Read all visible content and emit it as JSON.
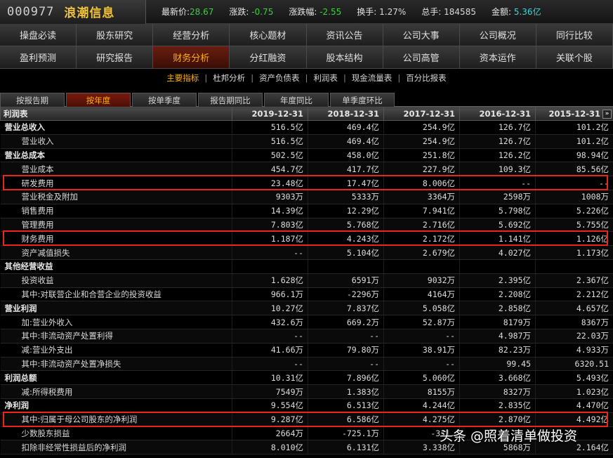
{
  "quote": {
    "code": "000977",
    "name": "浪潮信息",
    "latest_label": "最新价:",
    "latest_value": "28.67",
    "change_label": "涨跌:",
    "change_value": "-0.75",
    "pct_label": "涨跌幅:",
    "pct_value": "-2.55",
    "turnover_label": "换手:",
    "turnover_value": "1.27%",
    "volume_label": "总手:",
    "volume_value": "184585",
    "amount_label": "金额:",
    "amount_value": "5.36亿"
  },
  "nav": {
    "row1": [
      "操盘必读",
      "股东研究",
      "经营分析",
      "核心题材",
      "资讯公告",
      "公司大事",
      "公司概况",
      "同行比较"
    ],
    "row2": [
      "盈利预测",
      "研究报告",
      "财务分析",
      "分红融资",
      "股本结构",
      "公司高管",
      "资本运作",
      "关联个股"
    ],
    "active_row2_index": 2
  },
  "subtabs": [
    "主要指标",
    "杜邦分析",
    "资产负债表",
    "利润表",
    "现金流量表",
    "百分比报表"
  ],
  "subtab_sep": "|",
  "period_tabs": [
    "按报告期",
    "按年度",
    "按单季度",
    "报告期同比",
    "年度同比",
    "单季度环比"
  ],
  "table": {
    "header_label": "利润表",
    "columns": [
      "2019-12-31",
      "2018-12-31",
      "2017-12-31",
      "2016-12-31",
      "2015-12-31"
    ],
    "more_symbol": "»",
    "rows": [
      {
        "label": "营业总收入",
        "section": true,
        "values": [
          "516.5亿",
          "469.4亿",
          "254.9亿",
          "126.7亿",
          "101.2亿"
        ]
      },
      {
        "label": "营业收入",
        "section": false,
        "values": [
          "516.5亿",
          "469.4亿",
          "254.9亿",
          "126.7亿",
          "101.2亿"
        ]
      },
      {
        "label": "营业总成本",
        "section": true,
        "values": [
          "502.5亿",
          "458.0亿",
          "251.8亿",
          "126.2亿",
          "98.94亿"
        ]
      },
      {
        "label": "营业成本",
        "section": false,
        "values": [
          "454.7亿",
          "417.7亿",
          "227.9亿",
          "109.3亿",
          "85.56亿"
        ]
      },
      {
        "label": "研发费用",
        "section": false,
        "values": [
          "23.48亿",
          "17.47亿",
          "8.006亿",
          "--",
          "--"
        ]
      },
      {
        "label": "营业税金及附加",
        "section": false,
        "values": [
          "9303万",
          "5333万",
          "3364万",
          "2598万",
          "1008万"
        ]
      },
      {
        "label": "销售费用",
        "section": false,
        "values": [
          "14.39亿",
          "12.29亿",
          "7.941亿",
          "5.798亿",
          "5.226亿"
        ]
      },
      {
        "label": "管理费用",
        "section": false,
        "values": [
          "7.803亿",
          "5.768亿",
          "2.716亿",
          "5.692亿",
          "5.755亿"
        ]
      },
      {
        "label": "财务费用",
        "section": false,
        "values": [
          "1.187亿",
          "4.243亿",
          "2.172亿",
          "1.141亿",
          "1.126亿"
        ]
      },
      {
        "label": "资产减值损失",
        "section": false,
        "values": [
          "--",
          "5.104亿",
          "2.679亿",
          "4.027亿",
          "1.173亿"
        ]
      },
      {
        "label": "其他经营收益",
        "section": true,
        "values": [
          "",
          "",
          "",
          "",
          ""
        ]
      },
      {
        "label": "投资收益",
        "section": false,
        "values": [
          "1.628亿",
          "6591万",
          "9032万",
          "2.395亿",
          "2.367亿"
        ]
      },
      {
        "label": "其中:对联营企业和合营企业的投资收益",
        "section": false,
        "values": [
          "966.1万",
          "-2296万",
          "4164万",
          "2.208亿",
          "2.212亿"
        ]
      },
      {
        "label": "营业利润",
        "section": true,
        "values": [
          "10.27亿",
          "7.837亿",
          "5.058亿",
          "2.858亿",
          "4.657亿"
        ]
      },
      {
        "label": "加:营业外收入",
        "section": false,
        "values": [
          "432.6万",
          "669.2万",
          "52.87万",
          "8179万",
          "8367万"
        ]
      },
      {
        "label": "其中:非流动资产处置利得",
        "section": false,
        "values": [
          "--",
          "--",
          "--",
          "4.987万",
          "22.03万"
        ]
      },
      {
        "label": "减:营业外支出",
        "section": false,
        "values": [
          "41.66万",
          "79.80万",
          "38.91万",
          "82.23万",
          "4.933万"
        ]
      },
      {
        "label": "其中:非流动资产处置净损失",
        "section": false,
        "values": [
          "--",
          "--",
          "--",
          "99.45",
          "6320.51"
        ]
      },
      {
        "label": "利润总额",
        "section": true,
        "values": [
          "10.31亿",
          "7.896亿",
          "5.060亿",
          "3.668亿",
          "5.493亿"
        ]
      },
      {
        "label": "减:所得税费用",
        "section": false,
        "values": [
          "7549万",
          "1.383亿",
          "8155万",
          "8327万",
          "1.023亿"
        ]
      },
      {
        "label": "净利润",
        "section": true,
        "values": [
          "9.554亿",
          "6.513亿",
          "4.244亿",
          "2.835亿",
          "4.470亿"
        ]
      },
      {
        "label": "其中:归属于母公司股东的净利润",
        "section": false,
        "values": [
          "9.287亿",
          "6.586亿",
          "4.275亿",
          "2.870亿",
          "4.492亿"
        ]
      },
      {
        "label": "少数股东损益",
        "section": false,
        "values": [
          "2664万",
          "-725.1万",
          "-311.",
          "",
          ""
        ]
      },
      {
        "label": "扣除非经常性损益后的净利润",
        "section": false,
        "values": [
          "8.010亿",
          "6.131亿",
          "3.338亿",
          "5868万",
          "2.164亿"
        ]
      }
    ]
  },
  "watermark": "头条 @照着清单做投资"
}
